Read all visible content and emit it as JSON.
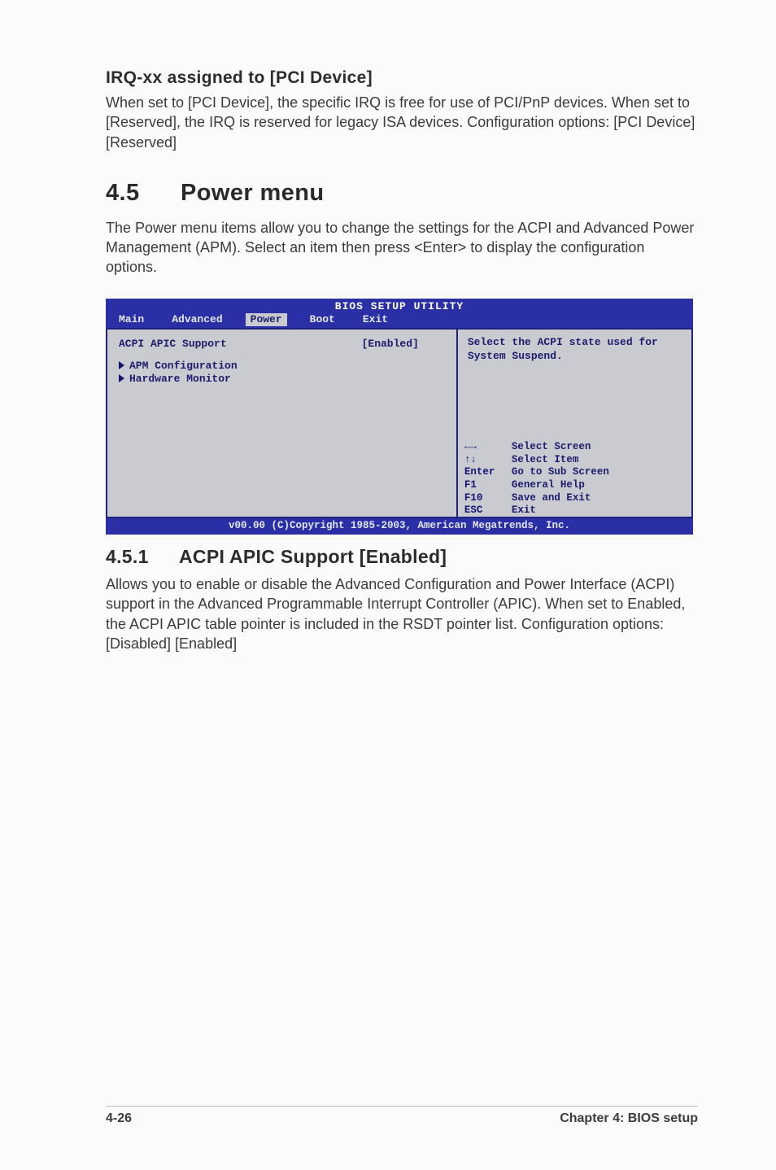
{
  "section_irq": {
    "heading": "IRQ-xx assigned to [PCI Device]",
    "body": "When set to [PCI Device], the specific IRQ is free for use of PCI/PnP devices. When set to [Reserved], the IRQ is reserved for legacy ISA devices. Configuration options: [PCI Device] [Reserved]"
  },
  "section_power": {
    "number": "4.5",
    "title": "Power menu",
    "body": "The Power menu items allow you to change the settings for the ACPI and Advanced Power Management (APM). Select an item then press <Enter> to display the configuration options."
  },
  "bios": {
    "title": "BIOS SETUP UTILITY",
    "tabs": [
      "Main",
      "Advanced",
      "Power",
      "Boot",
      "Exit"
    ],
    "active_tab_index": 2,
    "left": {
      "row": {
        "label": "ACPI APIC Support",
        "value": "[Enabled]"
      },
      "submenus": [
        "APM Configuration",
        "Hardware Monitor"
      ]
    },
    "right_top": "Select the ACPI state used for System Suspend.",
    "legend": [
      {
        "key": "←→",
        "label": "Select Screen"
      },
      {
        "key": "↑↓",
        "label": "Select Item"
      },
      {
        "key": "Enter",
        "label": "Go to Sub Screen"
      },
      {
        "key": "F1",
        "label": "General Help"
      },
      {
        "key": "F10",
        "label": "Save and Exit"
      },
      {
        "key": "ESC",
        "label": "Exit"
      }
    ],
    "footer": "v00.00 (C)Copyright 1985-2003, American Megatrends, Inc."
  },
  "section_acpi": {
    "number": "4.5.1",
    "title": "ACPI APIC Support [Enabled]",
    "body": "Allows you to enable or disable the Advanced Configuration and Power Interface (ACPI) support in the Advanced Programmable Interrupt Controller (APIC). When set to Enabled, the ACPI APIC table pointer is included in the RSDT pointer list. Configuration options: [Disabled] [Enabled]"
  },
  "footer": {
    "left": "4-26",
    "right": "Chapter 4: BIOS setup"
  }
}
